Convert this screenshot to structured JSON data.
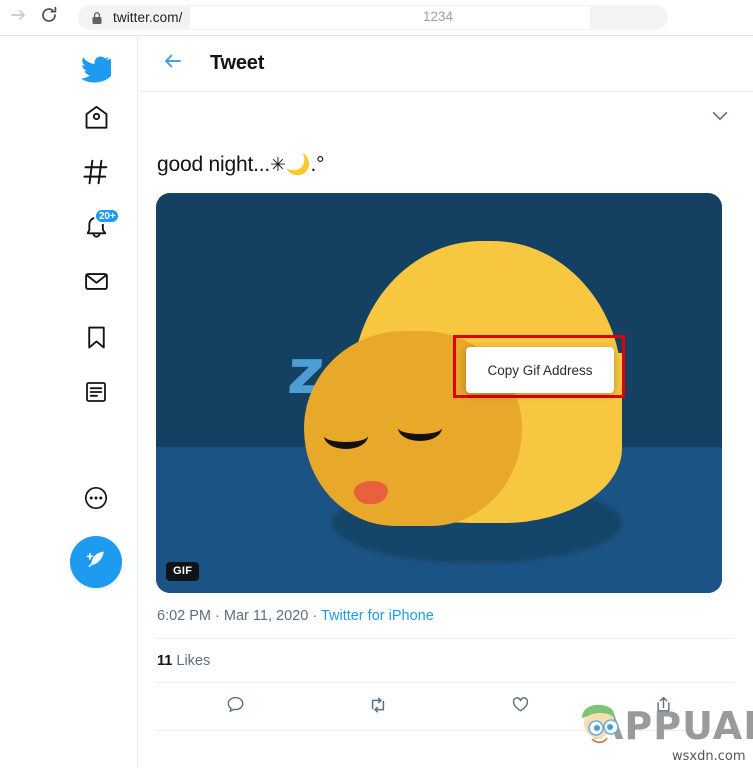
{
  "browser": {
    "forward_icon": "arrow-right-icon",
    "reload_icon": "reload-icon",
    "lock_icon": "lock-icon",
    "url": "twitter.com/",
    "url_extra": "1234"
  },
  "sidebar": {
    "items": [
      {
        "name": "twitter-logo",
        "icon": "twitter-bird-icon",
        "label": "Twitter"
      },
      {
        "name": "home",
        "icon": "home-icon",
        "label": "Home"
      },
      {
        "name": "explore",
        "icon": "hashtag-icon",
        "label": "Explore"
      },
      {
        "name": "notifications",
        "icon": "bell-icon",
        "label": "Notifications",
        "badge": "20+"
      },
      {
        "name": "messages",
        "icon": "envelope-icon",
        "label": "Messages"
      },
      {
        "name": "bookmarks",
        "icon": "bookmark-icon",
        "label": "Bookmarks"
      },
      {
        "name": "lists",
        "icon": "lists-icon",
        "label": "Lists"
      },
      {
        "name": "more",
        "icon": "more-dots-icon",
        "label": "More"
      },
      {
        "name": "compose-tweet",
        "icon": "quill-plus-icon",
        "label": "Tweet"
      }
    ],
    "badge_color": "#1d9bf0",
    "compose_color": "#1d9bf0"
  },
  "main": {
    "header": {
      "back_icon": "arrow-left-icon",
      "title": "Tweet"
    },
    "tweet": {
      "caret_icon": "chevron-down-icon",
      "text": "good night...",
      "emoji_star": "✳",
      "emoji_moon": "🌙",
      "text_suffix": ".°",
      "media": {
        "type": "gif",
        "badge": "GIF",
        "zzz_text": "z",
        "bg_color": "#144062",
        "floor_color": "#1c5385",
        "blob_light_color": "#f7c83f",
        "blob_face_color": "#e8a82a",
        "mouth_color": "#e9603c",
        "zzz_color": "#4e9ed6"
      },
      "meta": {
        "time": "6:02 PM",
        "dot1": "·",
        "date": "Mar 11, 2020",
        "dot2": "·",
        "source": "Twitter for iPhone"
      },
      "likes": {
        "count": "11",
        "label": "Likes"
      },
      "actions": [
        {
          "name": "reply",
          "icon": "comment-icon"
        },
        {
          "name": "retweet",
          "icon": "retweet-icon"
        },
        {
          "name": "like",
          "icon": "heart-icon"
        },
        {
          "name": "share",
          "icon": "share-icon"
        }
      ]
    }
  },
  "context_menu": {
    "items": [
      "Copy Gif Address"
    ],
    "highlight_color": "#e00000"
  },
  "watermark": {
    "brand": "APPUALS",
    "site": "wsxdn.com"
  }
}
